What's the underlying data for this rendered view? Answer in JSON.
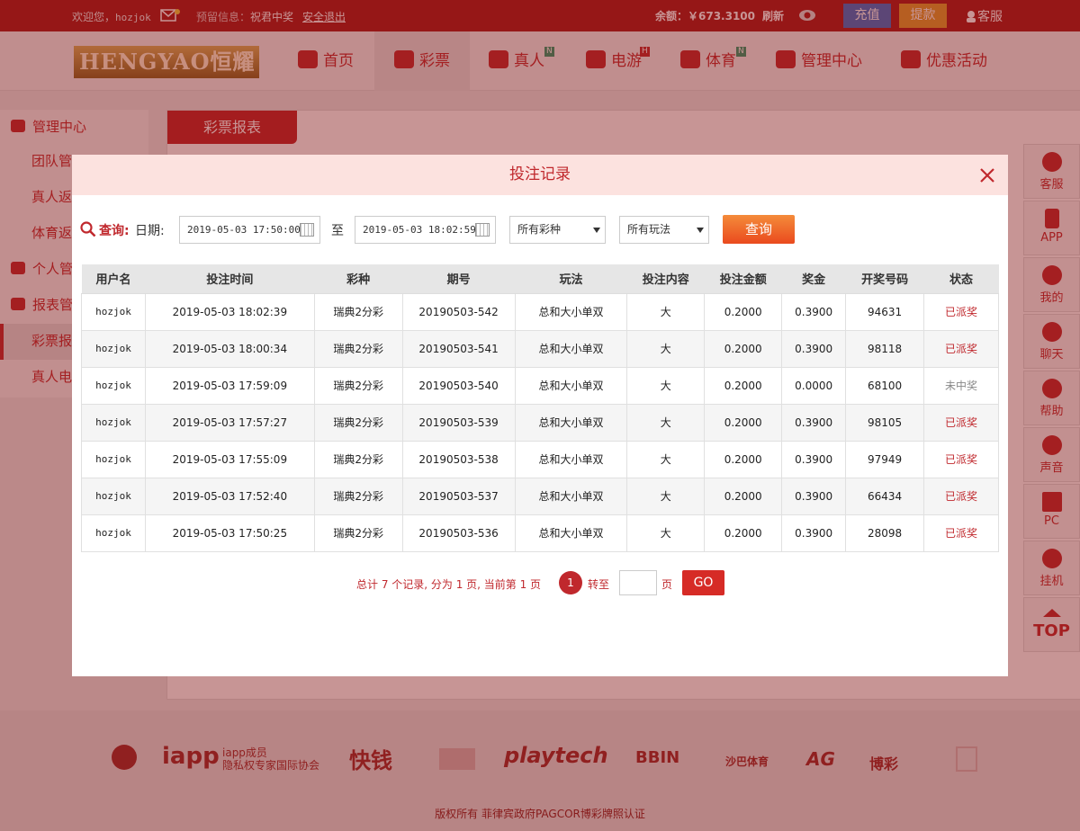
{
  "topbar": {
    "welcome": "欢迎您，",
    "username": "hozjok",
    "notice_label": "预留信息：",
    "notice_value": "祝君中奖",
    "logout": "安全退出",
    "balance": "余额：￥673.3100",
    "refresh": "刷新",
    "charge": "充值",
    "withdraw": "提款",
    "customer_service": "客服"
  },
  "logo": "HENGYAO恒耀",
  "nav": [
    {
      "label": "首页",
      "badge": ""
    },
    {
      "label": "彩票",
      "badge": ""
    },
    {
      "label": "真人",
      "badge": "N"
    },
    {
      "label": "电游",
      "badge": "H"
    },
    {
      "label": "体育",
      "badge": "N"
    },
    {
      "label": "管理中心",
      "badge": ""
    },
    {
      "label": "优惠活动",
      "badge": ""
    }
  ],
  "sidebar": [
    {
      "label": "管理中心"
    },
    {
      "label": "团队管"
    },
    {
      "label": "真人返"
    },
    {
      "label": "体育返"
    },
    {
      "label": "个人管"
    },
    {
      "label": "报表管"
    },
    {
      "label": "彩票报"
    },
    {
      "label": "真人电"
    }
  ],
  "main": {
    "tab": "彩票报表"
  },
  "rightbar": [
    "客服",
    "APP",
    "我的",
    "聊天",
    "帮助",
    "声音",
    "PC",
    "挂机",
    "TOP"
  ],
  "footer": {
    "logos": [
      "iapp",
      "iapp成员",
      "隐私权专家国际协会",
      "快钱",
      "playtech",
      "BBIN",
      "沙巴体育",
      "AG",
      "博彩"
    ],
    "copyright": "版权所有 菲律宾政府PAGCOR博彩牌照认证"
  },
  "modal": {
    "title": "投注记录",
    "query_label": "查询:",
    "date_label": "日期:",
    "date_from": "2019-05-03 17:50:00",
    "to_label": "至",
    "date_to": "2019-05-03 18:02:59",
    "lottery_select": "所有彩种",
    "play_select": "所有玩法",
    "query_button": "查询",
    "columns": [
      "用户名",
      "投注时间",
      "彩种",
      "期号",
      "玩法",
      "投注内容",
      "投注金额",
      "奖金",
      "开奖号码",
      "状态"
    ],
    "rows": [
      [
        "hozjok",
        "2019-05-03 18:02:39",
        "瑞典2分彩",
        "20190503-542",
        "总和大小单双",
        "大",
        "0.2000",
        "0.3900",
        "94631",
        "已派奖"
      ],
      [
        "hozjok",
        "2019-05-03 18:00:34",
        "瑞典2分彩",
        "20190503-541",
        "总和大小单双",
        "大",
        "0.2000",
        "0.3900",
        "98118",
        "已派奖"
      ],
      [
        "hozjok",
        "2019-05-03 17:59:09",
        "瑞典2分彩",
        "20190503-540",
        "总和大小单双",
        "大",
        "0.2000",
        "0.0000",
        "68100",
        "未中奖"
      ],
      [
        "hozjok",
        "2019-05-03 17:57:27",
        "瑞典2分彩",
        "20190503-539",
        "总和大小单双",
        "大",
        "0.2000",
        "0.3900",
        "98105",
        "已派奖"
      ],
      [
        "hozjok",
        "2019-05-03 17:55:09",
        "瑞典2分彩",
        "20190503-538",
        "总和大小单双",
        "大",
        "0.2000",
        "0.3900",
        "97949",
        "已派奖"
      ],
      [
        "hozjok",
        "2019-05-03 17:52:40",
        "瑞典2分彩",
        "20190503-537",
        "总和大小单双",
        "大",
        "0.2000",
        "0.3900",
        "66434",
        "已派奖"
      ],
      [
        "hozjok",
        "2019-05-03 17:50:25",
        "瑞典2分彩",
        "20190503-536",
        "总和大小单双",
        "大",
        "0.2000",
        "0.3900",
        "28098",
        "已派奖"
      ]
    ],
    "pagination": {
      "summary": "总计 7 个记录, 分为 1 页, 当前第 1 页",
      "current": "1",
      "goto_label": "转至",
      "page_label": "页",
      "go_button": "GO"
    }
  },
  "colors": {
    "brand": "#c0282d",
    "topbar": "#a61b1b",
    "header": "#fce2df"
  }
}
